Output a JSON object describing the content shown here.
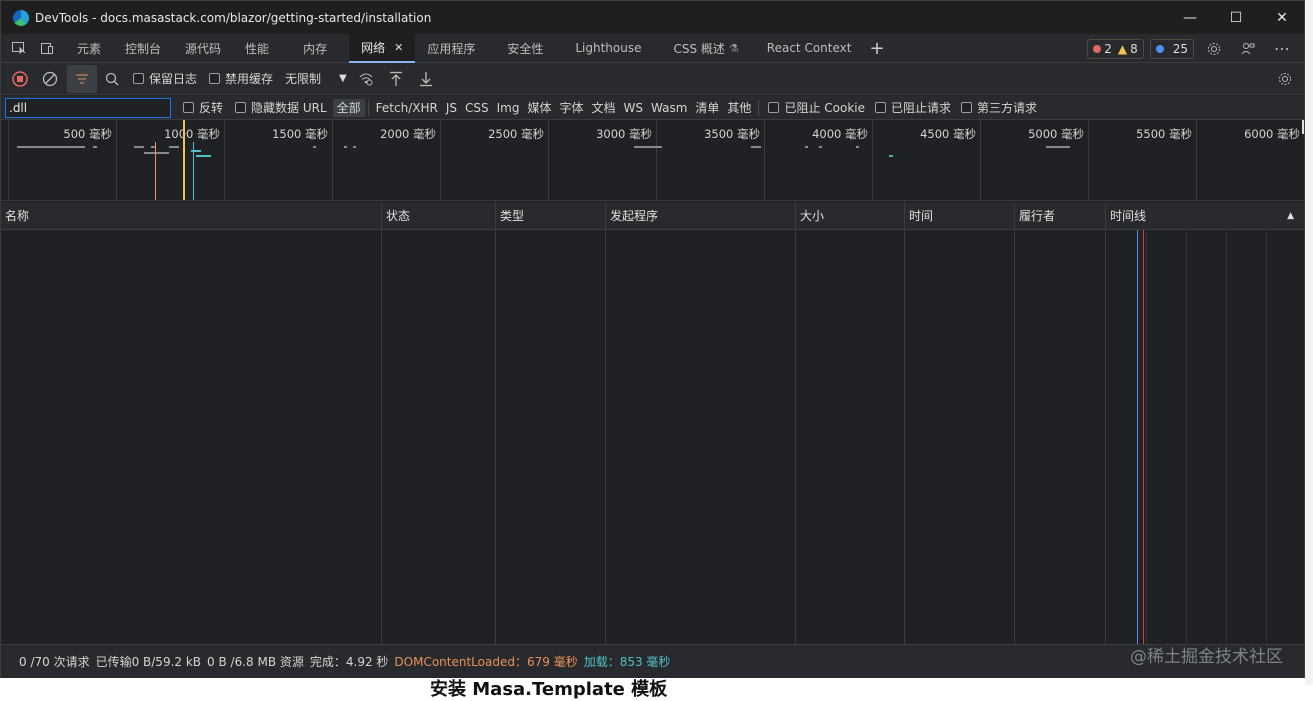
{
  "window": {
    "title": "DevTools - docs.masastack.com/blazor/getting-started/installation",
    "min_label": "—",
    "max_label": "☐",
    "close_label": "✕"
  },
  "tabs": [
    {
      "label": "元素"
    },
    {
      "label": "控制台"
    },
    {
      "label": "源代码"
    },
    {
      "label": "性能"
    },
    {
      "label": "内存"
    },
    {
      "label": "网络"
    },
    {
      "label": "应用程序"
    },
    {
      "label": "安全性"
    },
    {
      "label": "Lighthouse"
    },
    {
      "label": "CSS 概述"
    },
    {
      "label": "React Context"
    }
  ],
  "active_tab_close": "✕",
  "add_tab": "+",
  "badges": {
    "errors": "2",
    "warnings": "8",
    "info": "25",
    "colors": {
      "error": "#e46962",
      "warning": "#f2c14e",
      "info": "#4e8ff0"
    }
  },
  "toolbar": {
    "preserve_log": "保留日志",
    "disable_cache": "禁用缓存",
    "throttle": "无限制",
    "throttle_arrow": "▼"
  },
  "filter": {
    "value": ".dll",
    "invert": "反转",
    "hide_data_urls": "隐藏数据 URL",
    "types": [
      "全部",
      "Fetch/XHR",
      "JS",
      "CSS",
      "Img",
      "媒体",
      "字体",
      "文档",
      "WS",
      "Wasm",
      "清单",
      "其他"
    ],
    "blocked_cookies": "已阻止 Cookie",
    "blocked_requests": "已阻止请求",
    "third_party": "第三方请求"
  },
  "overview": {
    "ticks": [
      "500 毫秒",
      "1000 毫秒",
      "1500 毫秒",
      "2000 毫秒",
      "2500 毫秒",
      "3000 毫秒",
      "3500 毫秒",
      "4000 毫秒",
      "4500 毫秒",
      "5000 毫秒",
      "5500 毫秒",
      "6000 毫秒"
    ]
  },
  "columns": [
    "名称",
    "状态",
    "类型",
    "发起程序",
    "大小",
    "时间",
    "履行者",
    "时间线"
  ],
  "sort_arrow": "▲",
  "status": {
    "requests": "0 /70 次请求",
    "transferred": "已传输0 B/59.2 kB",
    "resources": "0 B /6.8 MB 资源",
    "finish": "完成：4.92 秒",
    "dom_label": "DOMContentLoaded：679 毫秒",
    "load_label": "加载：853 毫秒",
    "dom_color": "#e8915b",
    "load_color": "#4fc1c9"
  },
  "watermark": "@稀土掘金技术社区",
  "background_text": "安装 Masa.Template 模板"
}
